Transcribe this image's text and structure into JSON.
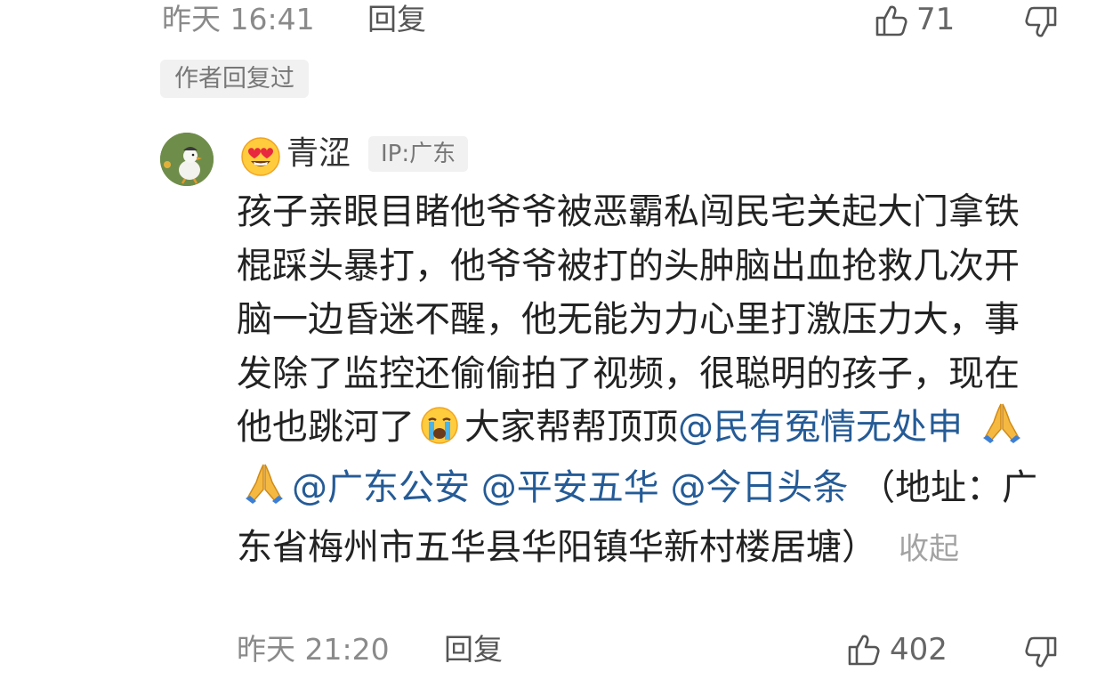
{
  "prev_comment": {
    "time": "昨天 16:41",
    "reply_label": "回复",
    "likes": "71",
    "author_replied_label": "作者回复过"
  },
  "comment": {
    "username": "青涩",
    "ip_label": "IP:广东",
    "text_1": "孩子亲眼目睹他爷爷被恶霸私闯民宅关起大门拿铁棍踩头暴打，他爷爷被打的头肿脑出血抢救几次开脑一边昏迷不醒，他无能为力心里打激压力大，事发除了监控还偷偷拍了视频，很聪明的孩子，现在他也跳河了",
    "text_2": "大家帮帮顶顶",
    "mention_1": "@民有冤情无处申",
    "mention_2": "@广东公安",
    "mention_3": "@平安五华",
    "mention_4": "@今日头条",
    "text_3": "（地址：广东省梅州市五华县华阳镇华新村楼居塘）",
    "collapse_label": "收起",
    "time": "昨天 21:20",
    "reply_label": "回复",
    "likes": "402"
  },
  "icons": {
    "like": "thumbs-up-icon",
    "dislike": "thumbs-down-icon",
    "face_emoji": "heart-eyes-emoji",
    "crying_emoji": "crying-face-emoji",
    "pray_emoji": "folded-hands-emoji"
  },
  "colors": {
    "mention": "#255b96",
    "meta_text": "#8a8a8a",
    "tag_bg": "#f1f1f1"
  }
}
